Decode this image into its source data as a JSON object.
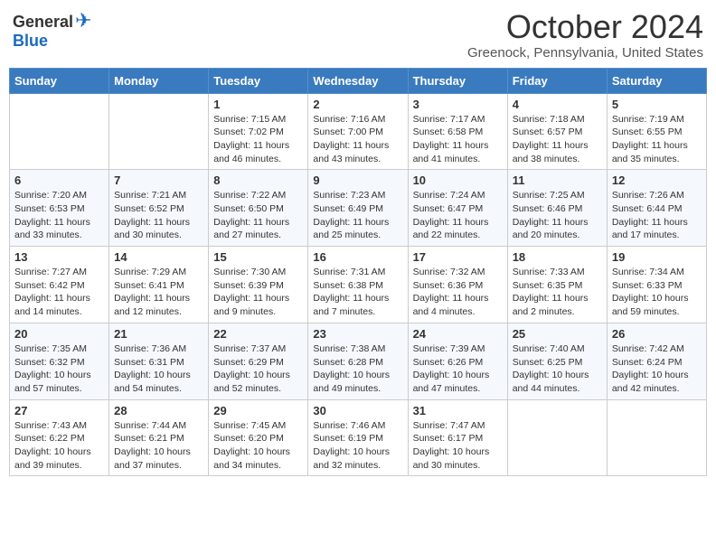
{
  "logo": {
    "general": "General",
    "blue": "Blue"
  },
  "title": "October 2024",
  "location": "Greenock, Pennsylvania, United States",
  "days_of_week": [
    "Sunday",
    "Monday",
    "Tuesday",
    "Wednesday",
    "Thursday",
    "Friday",
    "Saturday"
  ],
  "weeks": [
    [
      {
        "day": "",
        "content": ""
      },
      {
        "day": "",
        "content": ""
      },
      {
        "day": "1",
        "content": "Sunrise: 7:15 AM\nSunset: 7:02 PM\nDaylight: 11 hours and 46 minutes."
      },
      {
        "day": "2",
        "content": "Sunrise: 7:16 AM\nSunset: 7:00 PM\nDaylight: 11 hours and 43 minutes."
      },
      {
        "day": "3",
        "content": "Sunrise: 7:17 AM\nSunset: 6:58 PM\nDaylight: 11 hours and 41 minutes."
      },
      {
        "day": "4",
        "content": "Sunrise: 7:18 AM\nSunset: 6:57 PM\nDaylight: 11 hours and 38 minutes."
      },
      {
        "day": "5",
        "content": "Sunrise: 7:19 AM\nSunset: 6:55 PM\nDaylight: 11 hours and 35 minutes."
      }
    ],
    [
      {
        "day": "6",
        "content": "Sunrise: 7:20 AM\nSunset: 6:53 PM\nDaylight: 11 hours and 33 minutes."
      },
      {
        "day": "7",
        "content": "Sunrise: 7:21 AM\nSunset: 6:52 PM\nDaylight: 11 hours and 30 minutes."
      },
      {
        "day": "8",
        "content": "Sunrise: 7:22 AM\nSunset: 6:50 PM\nDaylight: 11 hours and 27 minutes."
      },
      {
        "day": "9",
        "content": "Sunrise: 7:23 AM\nSunset: 6:49 PM\nDaylight: 11 hours and 25 minutes."
      },
      {
        "day": "10",
        "content": "Sunrise: 7:24 AM\nSunset: 6:47 PM\nDaylight: 11 hours and 22 minutes."
      },
      {
        "day": "11",
        "content": "Sunrise: 7:25 AM\nSunset: 6:46 PM\nDaylight: 11 hours and 20 minutes."
      },
      {
        "day": "12",
        "content": "Sunrise: 7:26 AM\nSunset: 6:44 PM\nDaylight: 11 hours and 17 minutes."
      }
    ],
    [
      {
        "day": "13",
        "content": "Sunrise: 7:27 AM\nSunset: 6:42 PM\nDaylight: 11 hours and 14 minutes."
      },
      {
        "day": "14",
        "content": "Sunrise: 7:29 AM\nSunset: 6:41 PM\nDaylight: 11 hours and 12 minutes."
      },
      {
        "day": "15",
        "content": "Sunrise: 7:30 AM\nSunset: 6:39 PM\nDaylight: 11 hours and 9 minutes."
      },
      {
        "day": "16",
        "content": "Sunrise: 7:31 AM\nSunset: 6:38 PM\nDaylight: 11 hours and 7 minutes."
      },
      {
        "day": "17",
        "content": "Sunrise: 7:32 AM\nSunset: 6:36 PM\nDaylight: 11 hours and 4 minutes."
      },
      {
        "day": "18",
        "content": "Sunrise: 7:33 AM\nSunset: 6:35 PM\nDaylight: 11 hours and 2 minutes."
      },
      {
        "day": "19",
        "content": "Sunrise: 7:34 AM\nSunset: 6:33 PM\nDaylight: 10 hours and 59 minutes."
      }
    ],
    [
      {
        "day": "20",
        "content": "Sunrise: 7:35 AM\nSunset: 6:32 PM\nDaylight: 10 hours and 57 minutes."
      },
      {
        "day": "21",
        "content": "Sunrise: 7:36 AM\nSunset: 6:31 PM\nDaylight: 10 hours and 54 minutes."
      },
      {
        "day": "22",
        "content": "Sunrise: 7:37 AM\nSunset: 6:29 PM\nDaylight: 10 hours and 52 minutes."
      },
      {
        "day": "23",
        "content": "Sunrise: 7:38 AM\nSunset: 6:28 PM\nDaylight: 10 hours and 49 minutes."
      },
      {
        "day": "24",
        "content": "Sunrise: 7:39 AM\nSunset: 6:26 PM\nDaylight: 10 hours and 47 minutes."
      },
      {
        "day": "25",
        "content": "Sunrise: 7:40 AM\nSunset: 6:25 PM\nDaylight: 10 hours and 44 minutes."
      },
      {
        "day": "26",
        "content": "Sunrise: 7:42 AM\nSunset: 6:24 PM\nDaylight: 10 hours and 42 minutes."
      }
    ],
    [
      {
        "day": "27",
        "content": "Sunrise: 7:43 AM\nSunset: 6:22 PM\nDaylight: 10 hours and 39 minutes."
      },
      {
        "day": "28",
        "content": "Sunrise: 7:44 AM\nSunset: 6:21 PM\nDaylight: 10 hours and 37 minutes."
      },
      {
        "day": "29",
        "content": "Sunrise: 7:45 AM\nSunset: 6:20 PM\nDaylight: 10 hours and 34 minutes."
      },
      {
        "day": "30",
        "content": "Sunrise: 7:46 AM\nSunset: 6:19 PM\nDaylight: 10 hours and 32 minutes."
      },
      {
        "day": "31",
        "content": "Sunrise: 7:47 AM\nSunset: 6:17 PM\nDaylight: 10 hours and 30 minutes."
      },
      {
        "day": "",
        "content": ""
      },
      {
        "day": "",
        "content": ""
      }
    ]
  ]
}
